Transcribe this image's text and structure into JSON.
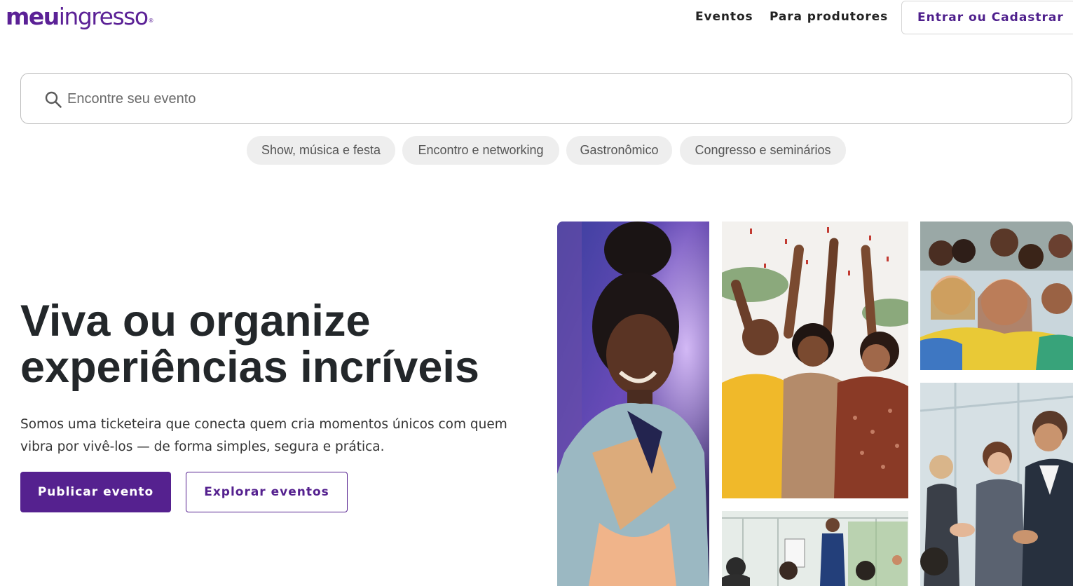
{
  "header": {
    "logo": {
      "part1": "meu",
      "part2": "ingresso",
      "mark": "®"
    },
    "nav": {
      "events": "Eventos",
      "producers": "Para produtores"
    },
    "login_label": "Entrar ou Cadastrar"
  },
  "search": {
    "placeholder": "Encontre seu evento",
    "value": "",
    "icon": "search-icon"
  },
  "categories": [
    "Show, música e festa",
    "Encontro e networking",
    "Gastronômico",
    "Congresso e seminários"
  ],
  "hero": {
    "title_line1": "Viva ou organize",
    "title_line2": "experiências incríveis",
    "description": "Somos uma ticketeira que conecta quem cria momentos únicos com quem vibra por vivê-los — de forma simples, segura e prática.",
    "primary_button": "Publicar evento",
    "secondary_button": "Explorar eventos"
  },
  "colors": {
    "brand": "#55218f",
    "chip_bg": "#eeeeee",
    "title": "#23272a"
  }
}
